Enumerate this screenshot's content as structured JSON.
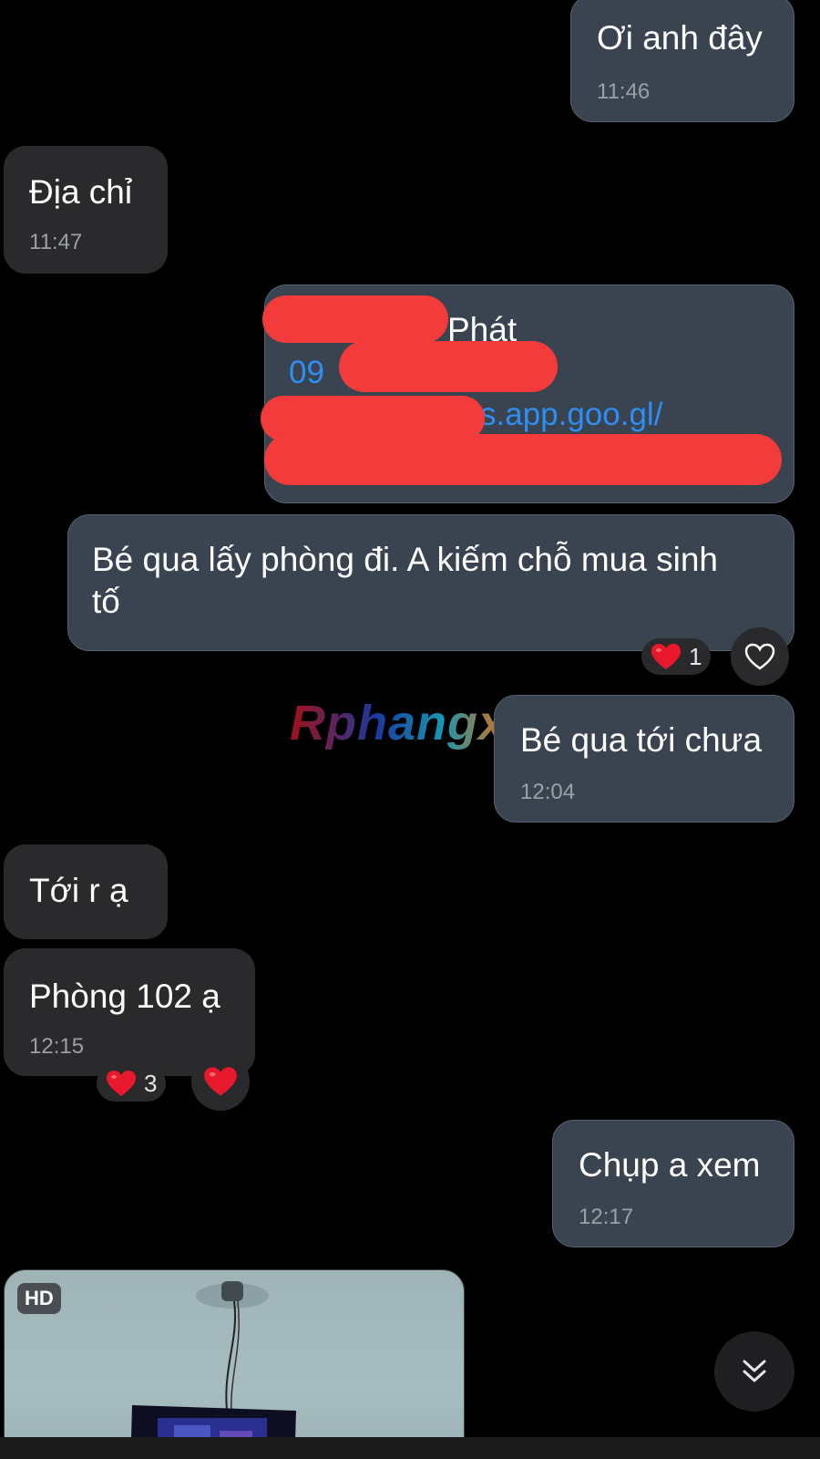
{
  "messages": [
    {
      "id": "m1",
      "direction": "outgoing",
      "text": "Ơi anh đây",
      "time": "11:46"
    },
    {
      "id": "m2",
      "direction": "incoming",
      "text": "Địa chỉ",
      "time": "11:47"
    },
    {
      "id": "m3",
      "direction": "outgoing",
      "name_visible": "Phát",
      "phone_visible": "09",
      "link_visible": "s.app.goo.gl/"
    },
    {
      "id": "m4",
      "direction": "outgoing",
      "line1": "Bé qua lấy phòng đi. A kiếm chỗ mua sinh",
      "line2": "tố",
      "reaction_count": "1"
    },
    {
      "id": "m5",
      "direction": "outgoing",
      "text": "Bé qua tới chưa",
      "time": "12:04"
    },
    {
      "id": "m6",
      "direction": "incoming",
      "text": "Tới r ạ"
    },
    {
      "id": "m7",
      "direction": "incoming",
      "text": "Phòng 102 ạ",
      "time": "12:15",
      "reaction_count": "3"
    },
    {
      "id": "m8",
      "direction": "outgoing",
      "text": "Chụp a xem",
      "time": "12:17"
    }
  ],
  "photo": {
    "badge": "HD"
  },
  "watermark": "Rphangx",
  "icons": {
    "heart_emoji": "heart-emoji-icon",
    "heart_outline": "heart-outline-icon",
    "scroll_down": "double-chevron-down-icon"
  },
  "colors": {
    "outgoing_bubble": "#3a4450",
    "incoming_bubble": "#2a2a2c",
    "link": "#2f8ef3",
    "redaction": "#f33b3b",
    "heart": "#e8192c"
  }
}
